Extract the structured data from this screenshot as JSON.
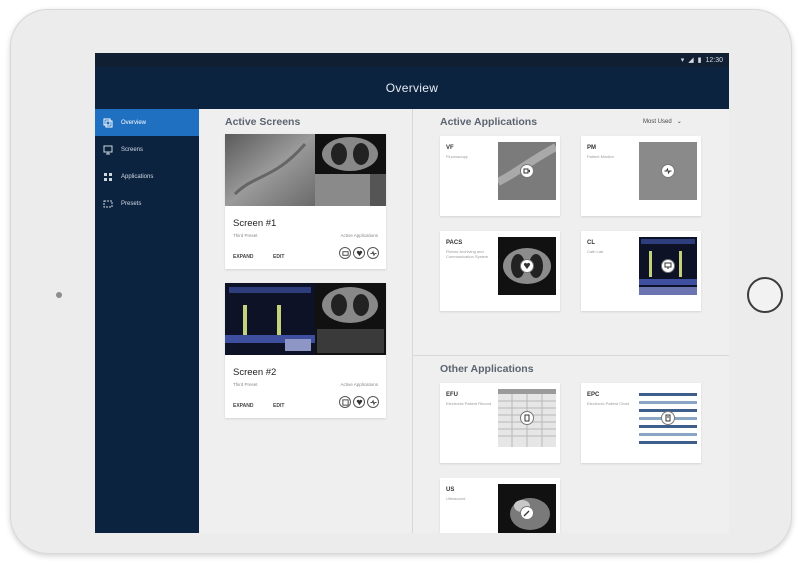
{
  "device": {
    "status_time": "12:30"
  },
  "header": {
    "title": "Overview"
  },
  "sidebar": {
    "items": [
      {
        "label": "Overview",
        "icon": "layers-icon",
        "active": true
      },
      {
        "label": "Screens",
        "icon": "monitor-icon",
        "active": false
      },
      {
        "label": "Applications",
        "icon": "grid-icon",
        "active": false
      },
      {
        "label": "Presets",
        "icon": "preset-icon",
        "active": false
      }
    ]
  },
  "active_screens": {
    "title": "Active Screens",
    "cards": [
      {
        "title": "Screen #1",
        "preset": "Third Preset",
        "apps_label": "Active Applications",
        "expand": "EXPAND",
        "edit": "EDIT"
      },
      {
        "title": "Screen #2",
        "preset": "Third Preset",
        "apps_label": "Active Applications",
        "expand": "EXPAND",
        "edit": "EDIT"
      }
    ]
  },
  "active_applications": {
    "title": "Active Applications",
    "sort_label": "Most Used",
    "apps": [
      {
        "name": "VF",
        "desc": "Fluoroscopy"
      },
      {
        "name": "PM",
        "desc": "Patient Monitor"
      },
      {
        "name": "PACS",
        "desc": "Picture Archiving and Communication System"
      },
      {
        "name": "CL",
        "desc": "Cath Lab"
      }
    ]
  },
  "other_applications": {
    "title": "Other Applications",
    "apps": [
      {
        "name": "EFU",
        "desc": "Electronic Patient Record"
      },
      {
        "name": "EPC",
        "desc": "Electronic Patient Chart"
      },
      {
        "name": "US",
        "desc": "Ultrasound"
      }
    ]
  },
  "colors": {
    "navy": "#0c2340",
    "accent_blue": "#1f70c1",
    "background": "#efefef"
  }
}
